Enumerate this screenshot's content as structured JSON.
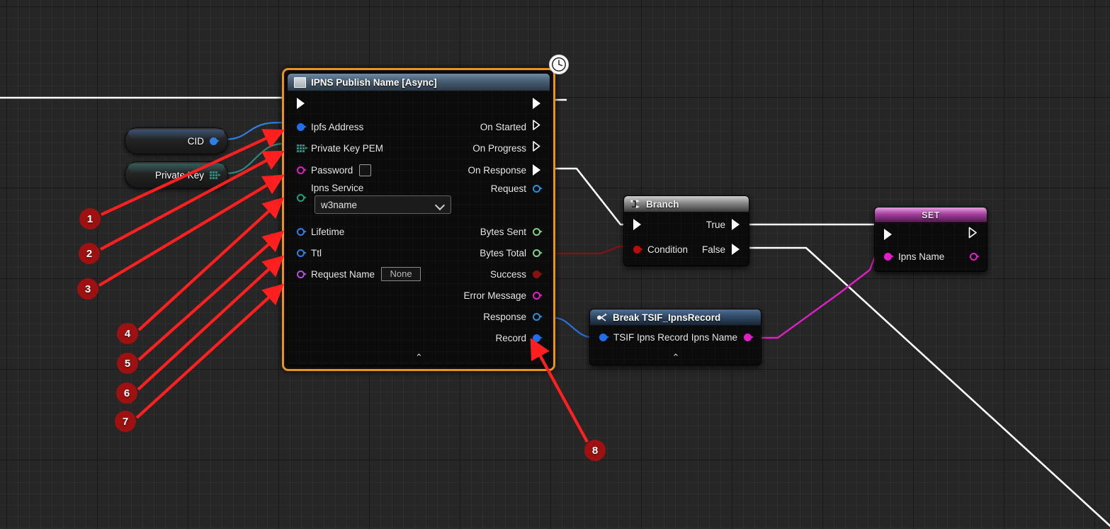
{
  "graph": {
    "background_color": "#262626",
    "grid_minor_color": "#2f2f2f",
    "grid_major_color": "#0a0a0a"
  },
  "nodes": {
    "ipns_publish": {
      "title": "IPNS Publish Name [Async]",
      "title_icon": "async-task-icon",
      "badge_icon": "clock-icon",
      "selected_color": "#e8941c",
      "collapse_glyph": "⌃",
      "inputs": [
        {
          "label": "",
          "pin": "exec-in",
          "type": "exec"
        },
        {
          "label": "Ipfs Address",
          "pin": "data-in",
          "type": "object",
          "color": "#1f6feb"
        },
        {
          "label": "Private Key PEM",
          "pin": "data-in",
          "type": "struct",
          "color": "#2d8a80"
        },
        {
          "label": "Password",
          "pin": "data-in",
          "type": "string",
          "color": "#e11ec7",
          "widget": "checkbox",
          "widget_value": ""
        },
        {
          "label": "Ipns Service",
          "pin": "data-in",
          "type": "enum",
          "color": "#1f9e7e",
          "widget": "combo",
          "widget_value": "w3name"
        },
        {
          "label": "Lifetime",
          "pin": "data-in",
          "type": "int",
          "color": "#2f7fe0"
        },
        {
          "label": "Ttl",
          "pin": "data-in",
          "type": "int",
          "color": "#2f7fe0"
        },
        {
          "label": "Request Name",
          "pin": "data-in",
          "type": "name",
          "color": "#b14fd8",
          "widget": "textbox",
          "widget_value": "None"
        }
      ],
      "outputs": [
        {
          "label": "",
          "pin": "exec-out",
          "type": "exec"
        },
        {
          "label": "On Started",
          "pin": "exec-out",
          "type": "exec-outline"
        },
        {
          "label": "On Progress",
          "pin": "exec-out",
          "type": "exec-outline"
        },
        {
          "label": "On Response",
          "pin": "exec-out",
          "type": "exec"
        },
        {
          "label": "Request",
          "pin": "data-out",
          "type": "object",
          "color": "#2b8fd6"
        },
        {
          "label": "Bytes Sent",
          "pin": "data-out",
          "type": "int64",
          "color": "#7fd17f"
        },
        {
          "label": "Bytes Total",
          "pin": "data-out",
          "type": "int64",
          "color": "#7fd17f"
        },
        {
          "label": "Success",
          "pin": "data-out",
          "type": "bool",
          "color": "#8b1111"
        },
        {
          "label": "Error Message",
          "pin": "data-out",
          "type": "string",
          "color": "#e11ec7"
        },
        {
          "label": "Response",
          "pin": "data-out",
          "type": "object",
          "color": "#2b8fd6"
        },
        {
          "label": "Record",
          "pin": "data-out",
          "type": "struct-ref",
          "color": "#1f6feb"
        }
      ]
    },
    "branch": {
      "title": "Branch",
      "title_icon": "branch-icon",
      "inputs": [
        {
          "label": "",
          "type": "exec"
        },
        {
          "label": "Condition",
          "type": "bool",
          "color": "#bb0b0b"
        }
      ],
      "outputs": [
        {
          "label": "True",
          "type": "exec"
        },
        {
          "label": "False",
          "type": "exec"
        }
      ]
    },
    "set_node": {
      "title": "SET",
      "inputs": [
        {
          "label": "",
          "type": "exec"
        },
        {
          "label": "Ipns Name",
          "type": "string",
          "color": "#e11ec7"
        }
      ],
      "outputs": [
        {
          "label": "",
          "type": "exec-outline"
        },
        {
          "label": "",
          "type": "string",
          "color": "#e11ec7"
        }
      ]
    },
    "break_record": {
      "title": "Break TSIF_IpnsRecord",
      "title_icon": "break-struct-icon",
      "collapse_glyph": "⌃",
      "inputs": [
        {
          "label": "TSIF Ipns Record",
          "type": "struct",
          "color": "#1f6feb"
        }
      ],
      "outputs": [
        {
          "label": "Ipns Name",
          "type": "string",
          "color": "#e11ec7"
        }
      ]
    },
    "var_cid": {
      "label": "CID",
      "pin_color": "#2f7fe0"
    },
    "var_private_key": {
      "label": "Private Key",
      "pin_color": "#2d8a80"
    }
  },
  "annotations": [
    {
      "id": "1",
      "label": "1"
    },
    {
      "id": "2",
      "label": "2"
    },
    {
      "id": "3",
      "label": "3"
    },
    {
      "id": "4",
      "label": "4"
    },
    {
      "id": "5",
      "label": "5"
    },
    {
      "id": "6",
      "label": "6"
    },
    {
      "id": "7",
      "label": "7"
    },
    {
      "id": "8",
      "label": "8"
    }
  ],
  "colors": {
    "annotation_badge": "#9f1010",
    "annotation_arrow": "#ff1f1f",
    "exec_wire": "#ffffff",
    "bool_wire": "#8b1111",
    "string_wire": "#e11ec7",
    "object_wire": "#2b6fd6",
    "struct_wire": "#2d8a80",
    "node_selected_border": "#e8941c"
  }
}
